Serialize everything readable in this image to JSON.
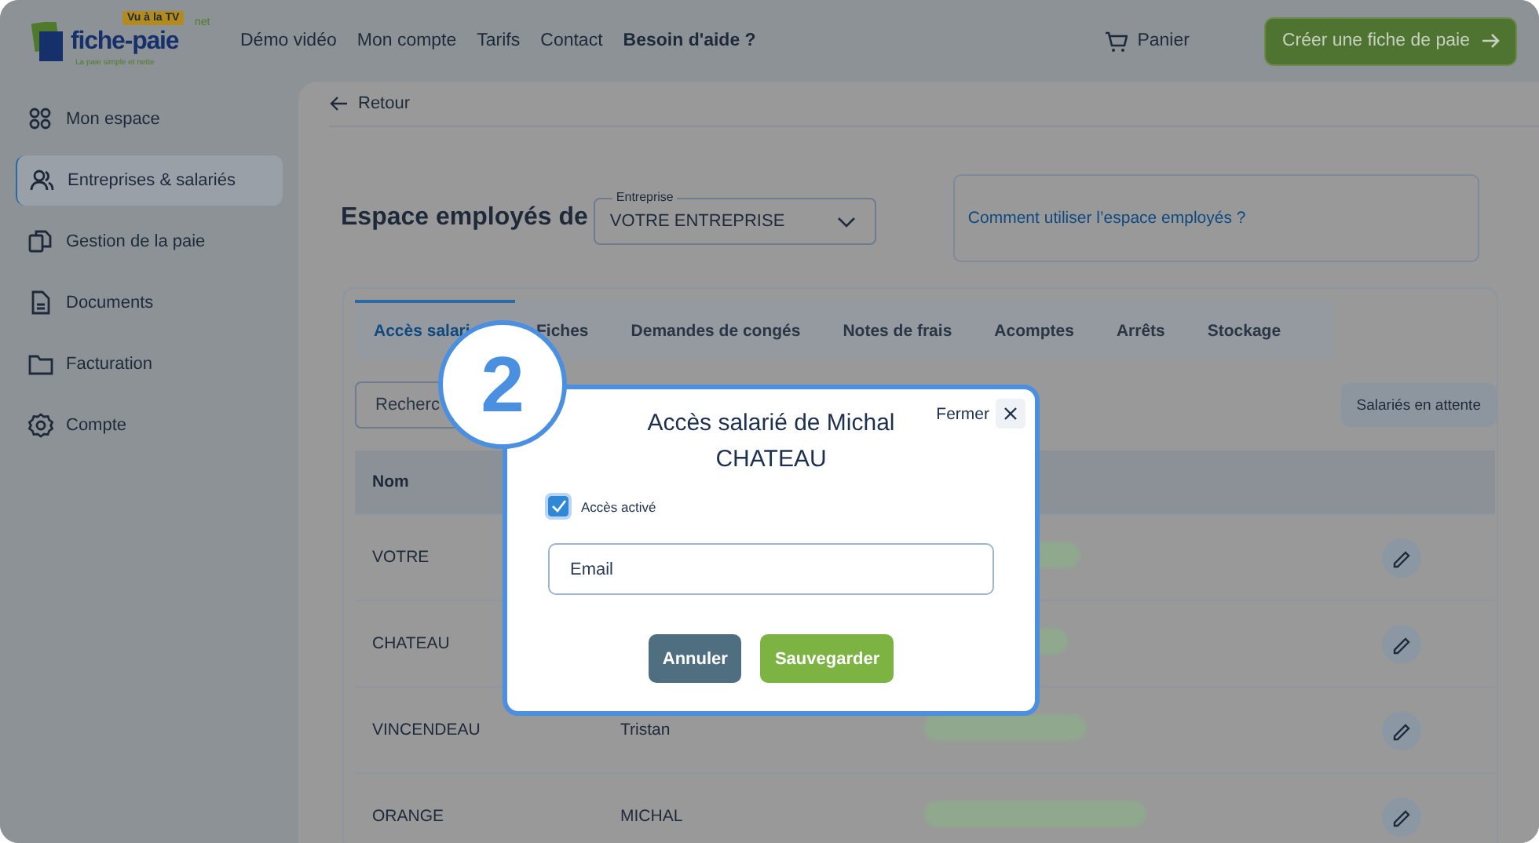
{
  "header": {
    "logo": {
      "name": "fiche-paie",
      "suffix": "net",
      "badge": "Vu à la TV",
      "tagline": "La paie simple et nette"
    },
    "nav": [
      {
        "label": "Démo vidéo",
        "bold": false
      },
      {
        "label": "Mon compte",
        "bold": false
      },
      {
        "label": "Tarifs",
        "bold": false
      },
      {
        "label": "Contact",
        "bold": false
      },
      {
        "label": "Besoin d'aide ?",
        "bold": true
      }
    ],
    "cart": "Panier",
    "cta": "Créer une fiche de paie"
  },
  "sidebar": {
    "items": [
      {
        "label": "Mon espace",
        "selected": false
      },
      {
        "label": "Entreprises & salariés",
        "selected": true
      },
      {
        "label": "Gestion de la paie",
        "selected": false
      },
      {
        "label": "Documents",
        "selected": false
      },
      {
        "label": "Facturation",
        "selected": false
      },
      {
        "label": "Compte",
        "selected": false
      }
    ]
  },
  "back": "Retour",
  "title": "Espace employés de",
  "company_select": {
    "label": "Entreprise",
    "value": "VOTRE ENTREPRISE"
  },
  "help_link": "Comment utiliser l’espace employés ?",
  "tabs": [
    {
      "label": "Accès salari",
      "selected": true
    },
    {
      "label": "Fiches",
      "selected": false
    },
    {
      "label": "Demandes de congés",
      "selected": false
    },
    {
      "label": "Notes de frais",
      "selected": false
    },
    {
      "label": "Acomptes",
      "selected": false
    },
    {
      "label": "Arrêts",
      "selected": false
    },
    {
      "label": "Stockage",
      "selected": false
    }
  ],
  "search": {
    "placeholder": "Recherc"
  },
  "pending_button": "Salariés en attente",
  "table": {
    "columns": [
      "Nom"
    ],
    "rows": [
      {
        "nom": "VOTRE"
      },
      {
        "nom": "CHATEAU"
      },
      {
        "nom": "VINCENDEAU",
        "prenom": "Tristan"
      },
      {
        "nom": "ORANGE",
        "prenom": "MICHAL"
      }
    ]
  },
  "step_badge": "2",
  "modal": {
    "title": "Accès salarié de Michal CHATEAU",
    "close": "Fermer",
    "checkbox": {
      "label": "Accès activé",
      "checked": true
    },
    "email_field": {
      "placeholder": "Email"
    },
    "buttons": [
      {
        "label": "Annuler",
        "kind": "secondary"
      },
      {
        "label": "Sauvegarder",
        "kind": "primary"
      }
    ]
  }
}
